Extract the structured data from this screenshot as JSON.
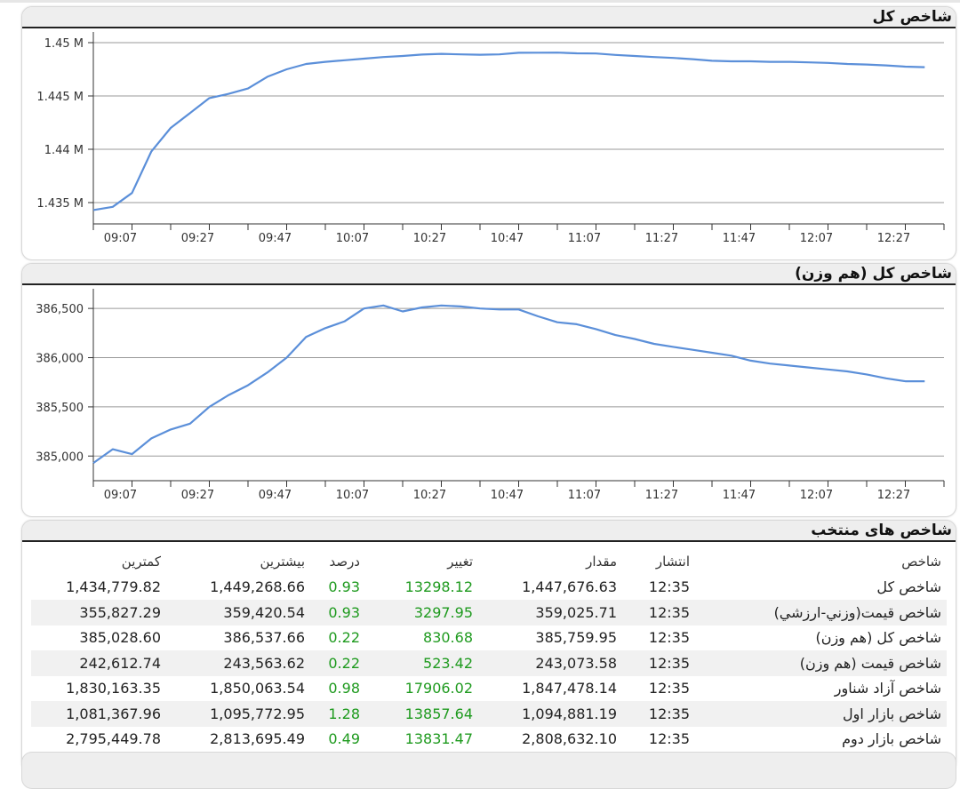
{
  "colors": {
    "line": "#5b8fd9",
    "green": "#1e9a1e",
    "header_bg": "#eeeeee"
  },
  "panels": {
    "chart1_title": "شاخص کل",
    "chart2_title": "شاخص کل (هم وزن)",
    "table_title": "شاخص های منتخب"
  },
  "chart_data": [
    {
      "type": "line",
      "title": "شاخص کل",
      "x_ticks": [
        "09:07",
        "09:27",
        "09:47",
        "10:07",
        "10:27",
        "10:47",
        "11:07",
        "11:27",
        "11:47",
        "12:07",
        "12:27"
      ],
      "y_ticks": [
        {
          "v": 1450000,
          "label": "1.45 M"
        },
        {
          "v": 1445000,
          "label": "1.445 M"
        },
        {
          "v": 1440000,
          "label": "1.44 M"
        },
        {
          "v": 1435000,
          "label": "1.435 M"
        }
      ],
      "ylim": [
        1433000,
        1451000
      ],
      "grid": true,
      "x_minutes": [
        540,
        545,
        550,
        555,
        560,
        565,
        570,
        575,
        580,
        585,
        590,
        595,
        600,
        605,
        610,
        615,
        620,
        625,
        630,
        635,
        640,
        645,
        650,
        655,
        660,
        665,
        670,
        675,
        680,
        685,
        690,
        695,
        700,
        705,
        710,
        715,
        720,
        725,
        730,
        735,
        740,
        745,
        750,
        755
      ],
      "y": [
        1434300,
        1434600,
        1435900,
        1439800,
        1442000,
        1443400,
        1444800,
        1445200,
        1445700,
        1446800,
        1447500,
        1448000,
        1448200,
        1448350,
        1448500,
        1448650,
        1448750,
        1448880,
        1448950,
        1448900,
        1448870,
        1448900,
        1449050,
        1449060,
        1449070,
        1449000,
        1448980,
        1448850,
        1448750,
        1448650,
        1448570,
        1448450,
        1448300,
        1448250,
        1448250,
        1448200,
        1448200,
        1448150,
        1448100,
        1448000,
        1447950,
        1447870,
        1447750,
        1447700
      ]
    },
    {
      "type": "line",
      "title": "شاخص کل (هم وزن)",
      "x_ticks": [
        "09:07",
        "09:27",
        "09:47",
        "10:07",
        "10:27",
        "10:47",
        "11:07",
        "11:27",
        "11:47",
        "12:07",
        "12:27"
      ],
      "y_ticks": [
        {
          "v": 386500,
          "label": "386,500"
        },
        {
          "v": 386000,
          "label": "386,000"
        },
        {
          "v": 385500,
          "label": "385,500"
        },
        {
          "v": 385000,
          "label": "385,000"
        }
      ],
      "ylim": [
        384750,
        386700
      ],
      "grid": true,
      "x_minutes": [
        540,
        545,
        550,
        555,
        560,
        565,
        570,
        575,
        580,
        585,
        590,
        595,
        600,
        605,
        610,
        615,
        620,
        625,
        630,
        635,
        640,
        645,
        650,
        655,
        660,
        665,
        670,
        675,
        680,
        685,
        690,
        695,
        700,
        705,
        710,
        715,
        720,
        725,
        730,
        735,
        740,
        745,
        750,
        755
      ],
      "y": [
        384930,
        385070,
        385020,
        385180,
        385270,
        385330,
        385500,
        385620,
        385720,
        385850,
        386000,
        386210,
        386300,
        386370,
        386500,
        386530,
        386470,
        386510,
        386530,
        386520,
        386500,
        386490,
        386490,
        386420,
        386360,
        386340,
        386290,
        386230,
        386190,
        386140,
        386110,
        386080,
        386050,
        386020,
        385970,
        385940,
        385920,
        385900,
        385880,
        385860,
        385830,
        385790,
        385760,
        385760
      ]
    }
  ],
  "table": {
    "headers": {
      "name": "شاخص",
      "time": "انتشار",
      "value": "مقدار",
      "change": "تغییر",
      "percent": "درصد",
      "max": "بیشترین",
      "min": "کمترین"
    },
    "rows": [
      {
        "name": "شاخص کل",
        "time": "12:35",
        "value": "1,447,676.63",
        "change": "13298.12",
        "percent": "0.93",
        "max": "1,449,268.66",
        "min": "1,434,779.82"
      },
      {
        "name": "شاخص قیمت(وزني-ارزشي)",
        "time": "12:35",
        "value": "359,025.71",
        "change": "3297.95",
        "percent": "0.93",
        "max": "359,420.54",
        "min": "355,827.29"
      },
      {
        "name": "شاخص کل (هم وزن)",
        "time": "12:35",
        "value": "385,759.95",
        "change": "830.68",
        "percent": "0.22",
        "max": "386,537.66",
        "min": "385,028.60"
      },
      {
        "name": "شاخص قیمت (هم وزن)",
        "time": "12:35",
        "value": "243,073.58",
        "change": "523.42",
        "percent": "0.22",
        "max": "243,563.62",
        "min": "242,612.74"
      },
      {
        "name": "شاخص آزاد شناور",
        "time": "12:35",
        "value": "1,847,478.14",
        "change": "17906.02",
        "percent": "0.98",
        "max": "1,850,063.54",
        "min": "1,830,163.35"
      },
      {
        "name": "شاخص بازار اول",
        "time": "12:35",
        "value": "1,094,881.19",
        "change": "13857.64",
        "percent": "1.28",
        "max": "1,095,772.95",
        "min": "1,081,367.96"
      },
      {
        "name": "شاخص بازار دوم",
        "time": "12:35",
        "value": "2,808,632.10",
        "change": "13831.47",
        "percent": "0.49",
        "max": "2,813,695.49",
        "min": "2,795,449.78"
      }
    ]
  }
}
